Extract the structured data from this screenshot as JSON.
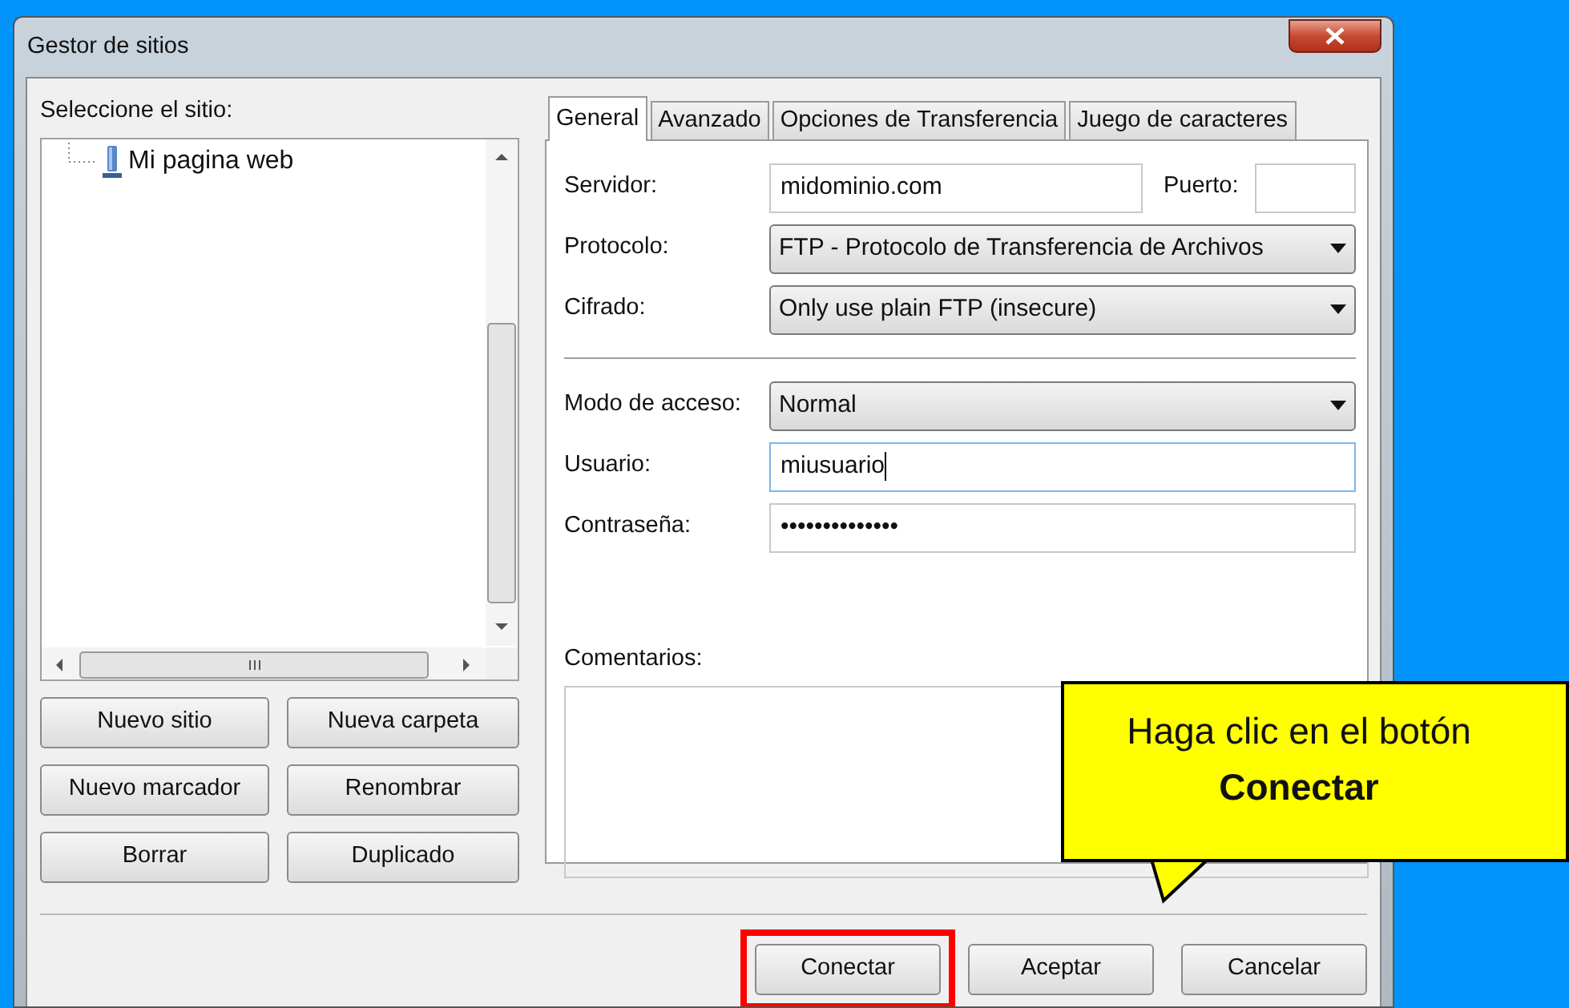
{
  "window": {
    "title": "Gestor de sitios"
  },
  "site_tree": {
    "label": "Seleccione el sitio:",
    "items": [
      {
        "label": "Mi pagina web",
        "selected": false
      }
    ]
  },
  "site_buttons": [
    "Nuevo sitio",
    "Nueva carpeta",
    "Nuevo marcador",
    "Renombrar",
    "Borrar",
    "Duplicado"
  ],
  "tabs": [
    {
      "label": "General",
      "selected": true
    },
    {
      "label": "Avanzado",
      "selected": false
    },
    {
      "label": "Opciones de Transferencia",
      "selected": false
    },
    {
      "label": "Juego de caracteres",
      "selected": false
    }
  ],
  "connection": [
    {
      "kind": "host",
      "label": "Servidor:",
      "value": "midominio.com",
      "port_label": "Puerto:"
    },
    {
      "kind": "select",
      "label": "Protocolo:",
      "value": "FTP - Protocolo de Transferencia de Archivos"
    },
    {
      "kind": "select",
      "label": "Cifrado:",
      "value": "Only use plain FTP (insecure)"
    }
  ],
  "account": [
    {
      "kind": "select",
      "label": "Modo de acceso:",
      "value": "Normal",
      "focused": false
    },
    {
      "kind": "text",
      "label": "Usuario:",
      "value": "miusuario",
      "focused": true
    },
    {
      "kind": "text",
      "label": "Contraseña:",
      "value": "••••••••••••••",
      "focused": false
    }
  ],
  "comments": {
    "label": "Comentarios:"
  },
  "dialog_buttons": [
    {
      "label": "Conectar",
      "highlighted": true
    },
    {
      "label": "Aceptar",
      "highlighted": false
    },
    {
      "label": "Cancelar",
      "highlighted": false
    }
  ],
  "callout": {
    "text": "Haga clic en el botón **Conectar**"
  }
}
